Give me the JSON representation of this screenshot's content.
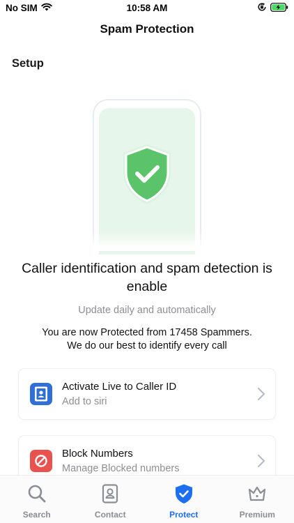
{
  "status_bar": {
    "carrier": "No SIM",
    "time": "10:58 AM"
  },
  "nav": {
    "title": "Spam Protection"
  },
  "section": {
    "label": "Setup"
  },
  "hero": {
    "headline": "Caller identification and spam detection is enable",
    "subline": "Update daily and automatically",
    "protected_line1": "You are now Protected from 17458 Spammers.",
    "protected_line2": "We do our best to identify every call"
  },
  "cards": [
    {
      "title": "Activate Live to Caller ID",
      "subtitle": "Add to siri",
      "icon": "contact-card-icon",
      "icon_color": "#2f6fd6"
    },
    {
      "title": "Block Numbers",
      "subtitle": "Manage Blocked numbers",
      "icon": "block-icon",
      "icon_color": "#e8534f"
    }
  ],
  "tabs": [
    {
      "label": "Search",
      "icon": "magnifier-icon",
      "active": false
    },
    {
      "label": "Contact",
      "icon": "contact-card-icon",
      "active": false
    },
    {
      "label": "Protect",
      "icon": "shield-check-icon",
      "active": true
    },
    {
      "label": "Premium",
      "icon": "crown-icon",
      "active": false
    }
  ],
  "colors": {
    "accent": "#1e6ef1",
    "shield_green": "#5bc46a",
    "phone_bg": "#e7f6ea",
    "inactive_tab": "#8a8d93",
    "secondary_text": "#8e8e93"
  }
}
